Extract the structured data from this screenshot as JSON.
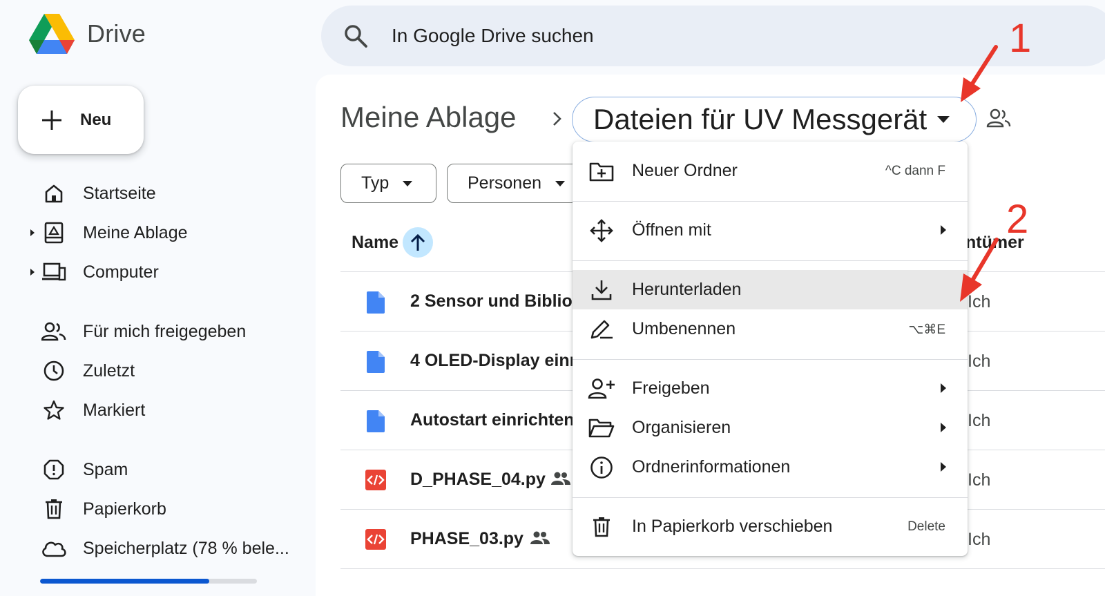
{
  "app": {
    "name": "Drive"
  },
  "search": {
    "placeholder": "In Google Drive suchen"
  },
  "sidebar": {
    "new_label": "Neu",
    "items": [
      {
        "label": "Startseite",
        "icon": "home-icon"
      },
      {
        "label": "Meine Ablage",
        "icon": "my-drive-icon"
      },
      {
        "label": "Computer",
        "icon": "computer-icon"
      },
      {
        "label": "Für mich freigegeben",
        "icon": "shared-people-icon"
      },
      {
        "label": "Zuletzt",
        "icon": "clock-icon"
      },
      {
        "label": "Markiert",
        "icon": "star-icon"
      },
      {
        "label": "Spam",
        "icon": "spam-icon"
      },
      {
        "label": "Papierkorb",
        "icon": "trash-icon"
      },
      {
        "label": "Speicherplatz (78 % bele...",
        "icon": "cloud-icon"
      }
    ],
    "storage_used_fraction": 0.78
  },
  "breadcrumb": {
    "root": "Meine Ablage",
    "current": "Dateien für UV Messgerät"
  },
  "filters": {
    "type_label": "Typ",
    "people_label": "Personen"
  },
  "table": {
    "col_name": "Name",
    "col_owner": "ntümer",
    "rows": [
      {
        "name": "2 Sensor und Bibliot",
        "type": "doc",
        "shared": false,
        "owner": "Ich"
      },
      {
        "name": "4 OLED-Display einr",
        "type": "doc",
        "shared": false,
        "owner": "Ich"
      },
      {
        "name": "Autostart einrichten",
        "type": "doc",
        "shared": false,
        "owner": "Ich"
      },
      {
        "name": "D_PHASE_04.py",
        "type": "code",
        "shared": true,
        "owner": "Ich"
      },
      {
        "name": "PHASE_03.py",
        "type": "code",
        "shared": true,
        "owner": "Ich"
      }
    ]
  },
  "context_menu": {
    "items": [
      {
        "label": "Neuer Ordner",
        "shortcut": "^C dann F",
        "icon": "new-folder-icon",
        "submenu": false
      },
      {
        "label": "Öffnen mit",
        "shortcut": "",
        "icon": "open-with-icon",
        "submenu": true
      },
      {
        "label": "Herunterladen",
        "shortcut": "",
        "icon": "download-icon",
        "submenu": false,
        "highlighted": true
      },
      {
        "label": "Umbenennen",
        "shortcut": "⌥⌘E",
        "icon": "rename-icon",
        "submenu": false
      },
      {
        "label": "Freigeben",
        "shortcut": "",
        "icon": "share-person-icon",
        "submenu": true
      },
      {
        "label": "Organisieren",
        "shortcut": "",
        "icon": "folder-open-icon",
        "submenu": true
      },
      {
        "label": "Ordnerinformationen",
        "shortcut": "",
        "icon": "info-icon",
        "submenu": true
      },
      {
        "label": "In Papierkorb verschieben",
        "shortcut": "Delete",
        "icon": "trash-icon",
        "submenu": false
      }
    ]
  },
  "annotations": {
    "marker_1": "1",
    "marker_2": "2",
    "color": "#e8362a"
  },
  "colors": {
    "accent": "#0b57d0",
    "doc_blue": "#4285f4",
    "code_red": "#ea4335",
    "hover_gray": "#e8e8e8"
  }
}
